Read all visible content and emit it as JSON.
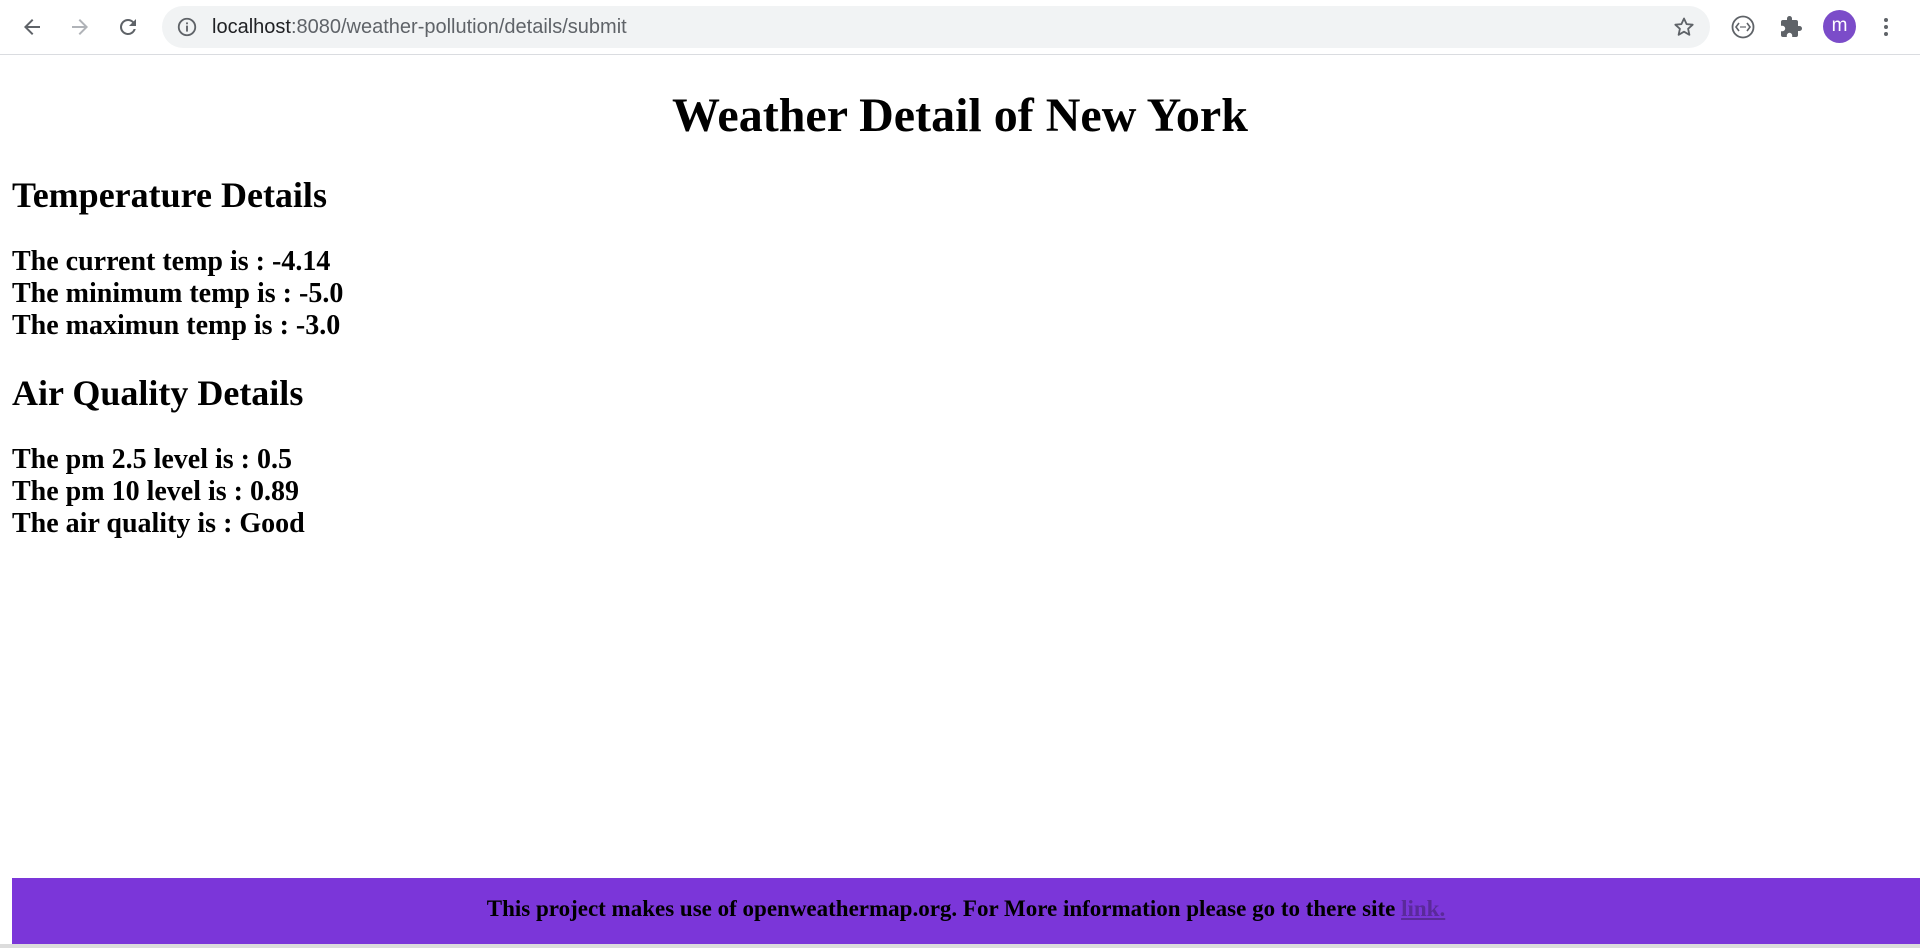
{
  "browser": {
    "url_host": "localhost",
    "url_rest": ":8080/weather-pollution/details/submit",
    "profile_initial": "m",
    "accent_color": "#7b4cc9"
  },
  "page": {
    "title": "Weather Detail of New York",
    "temperature": {
      "heading": "Temperature Details",
      "lines": [
        "The current temp is : -4.14",
        "The minimum temp is : -5.0",
        "The maximun temp is : -3.0"
      ]
    },
    "air_quality": {
      "heading": "Air Quality Details",
      "lines": [
        "The pm 2.5 level is : 0.5",
        "The pm 10 level is : 0.89",
        "The air quality is : Good"
      ]
    }
  },
  "footer": {
    "text": "This project makes use of openweathermap.org. For More information please go to there site ",
    "link_text": "link.",
    "background": "#7b36d9"
  },
  "icons": [
    "back-arrow-icon",
    "forward-arrow-icon",
    "reload-icon",
    "info-icon",
    "star-icon",
    "reading-mode-icon",
    "extensions-puzzle-icon",
    "kebab-menu-icon"
  ]
}
